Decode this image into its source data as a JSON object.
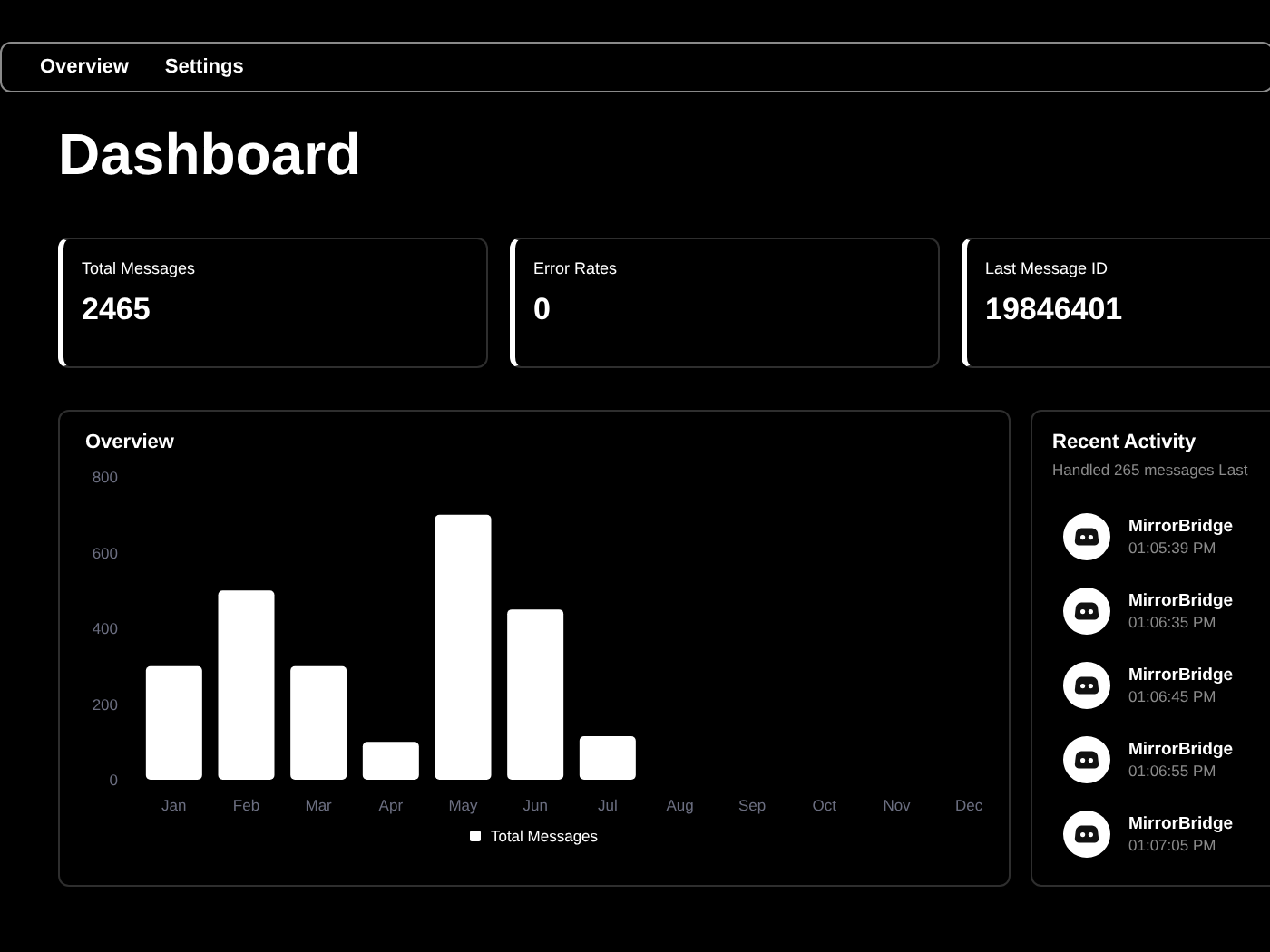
{
  "nav": {
    "items": [
      "Overview",
      "Settings"
    ]
  },
  "title": "Dashboard",
  "stats": [
    {
      "label": "Total Messages",
      "value": "2465"
    },
    {
      "label": "Error Rates",
      "value": "0"
    },
    {
      "label": "Last Message ID",
      "value": "19846401"
    }
  ],
  "overview": {
    "title": "Overview",
    "chart_data": {
      "type": "bar",
      "categories": [
        "Jan",
        "Feb",
        "Mar",
        "Apr",
        "May",
        "Jun",
        "Jul",
        "Aug",
        "Sep",
        "Oct",
        "Nov",
        "Dec"
      ],
      "series": [
        {
          "name": "Total Messages",
          "color": "#ffffff",
          "values": [
            300,
            500,
            300,
            100,
            700,
            450,
            115,
            0,
            0,
            0,
            0,
            0
          ]
        }
      ],
      "ylim": [
        0,
        800
      ],
      "yticks": [
        0,
        200,
        400,
        600,
        800
      ]
    }
  },
  "recent": {
    "title": "Recent Activity",
    "subtitle": "Handled 265 messages Last",
    "items": [
      {
        "name": "MirrorBridge",
        "time": "01:05:39 PM"
      },
      {
        "name": "MirrorBridge",
        "time": "01:06:35 PM"
      },
      {
        "name": "MirrorBridge",
        "time": "01:06:45 PM"
      },
      {
        "name": "MirrorBridge",
        "time": "01:06:55 PM"
      },
      {
        "name": "MirrorBridge",
        "time": "01:07:05 PM"
      }
    ]
  }
}
